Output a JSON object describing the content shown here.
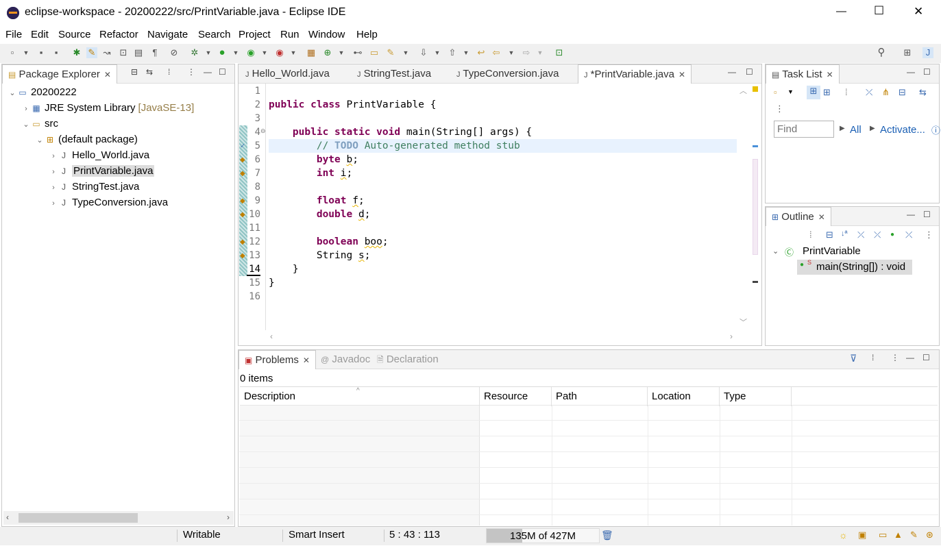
{
  "window": {
    "title": "eclipse-workspace - 20200222/src/PrintVariable.java - Eclipse IDE",
    "controls": {
      "minimize": "—",
      "maximize": "☐",
      "close": "✕"
    }
  },
  "menu": [
    "File",
    "Edit",
    "Source",
    "Refactor",
    "Navigate",
    "Search",
    "Project",
    "Run",
    "Window",
    "Help"
  ],
  "package_explorer": {
    "title": "Package Explorer",
    "tree": [
      {
        "label": "20200222",
        "depth": 0,
        "twisty": "⌄",
        "icon": "project-icon"
      },
      {
        "label": "JRE System Library",
        "suffix": "[JavaSE-13]",
        "depth": 1,
        "twisty": "›",
        "icon": "library-icon"
      },
      {
        "label": "src",
        "depth": 1,
        "twisty": "⌄",
        "icon": "source-folder-icon"
      },
      {
        "label": "(default package)",
        "depth": 2,
        "twisty": "⌄",
        "icon": "package-icon"
      },
      {
        "label": "Hello_World.java",
        "depth": 3,
        "twisty": "›",
        "icon": "java-file-icon"
      },
      {
        "label": "PrintVariable.java",
        "depth": 3,
        "twisty": "›",
        "icon": "java-file-icon",
        "selected": true
      },
      {
        "label": "StringTest.java",
        "depth": 3,
        "twisty": "›",
        "icon": "java-file-icon"
      },
      {
        "label": "TypeConversion.java",
        "depth": 3,
        "twisty": "›",
        "icon": "java-file-icon"
      }
    ]
  },
  "editor": {
    "tabs": [
      {
        "label": "Hello_World.java",
        "active": false
      },
      {
        "label": "StringTest.java",
        "active": false
      },
      {
        "label": "TypeConversion.java",
        "active": false
      },
      {
        "label": "*PrintVariable.java",
        "active": true
      }
    ],
    "line_numbers": [
      "1",
      "2",
      "3",
      "4",
      "5",
      "6",
      "7",
      "8",
      "9",
      "10",
      "11",
      "12",
      "13",
      "14",
      "15",
      "16"
    ]
  },
  "task_list": {
    "title": "Task List",
    "find_placeholder": "Find",
    "all_label": "All",
    "activate_label": "Activate..."
  },
  "outline": {
    "title": "Outline",
    "class_name": "PrintVariable",
    "method": "main(String[]) : void"
  },
  "bottom": {
    "tabs": [
      "Problems",
      "Javadoc",
      "Declaration"
    ],
    "items_count": "0 items",
    "columns": [
      "Description",
      "Resource",
      "Path",
      "Location",
      "Type"
    ]
  },
  "status": {
    "writable": "Writable",
    "insert_mode": "Smart Insert",
    "position": "5 : 43 : 113",
    "memory": "135M of 427M",
    "memory_fraction": 0.32
  },
  "colors": {
    "keyword": "#7f0055",
    "comment": "#3f7f5f",
    "todo": "#7f9fbf",
    "current_line": "#e8f2fe",
    "warning": "#e8b400"
  }
}
